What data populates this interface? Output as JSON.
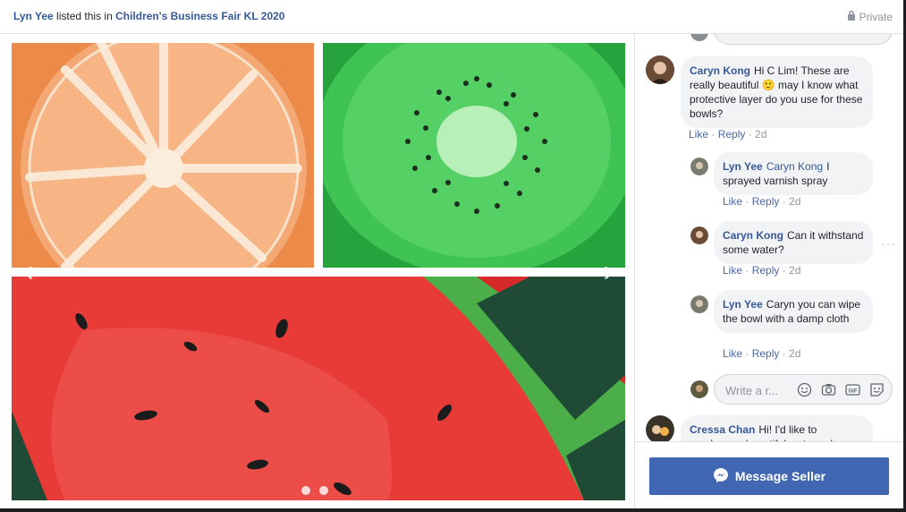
{
  "header": {
    "seller": "Lyn Yee",
    "listed_text": "listed this in",
    "group": "Children's Business Fair KL 2020",
    "privacy": "Private"
  },
  "photo": {
    "prev_icon": "chevron-left-icon",
    "next_icon": "chevron-right-icon",
    "dots": 2
  },
  "comments": [
    {
      "name": "Caryn Kong",
      "text": "Hi C Lim! These are really beautiful",
      "emoji": "🙂",
      "text2": "may I know what protective layer do you use for these bowls?",
      "like": "Like",
      "reply": "Reply",
      "time": "2d"
    },
    {
      "name": "Lyn Yee",
      "tag": "Caryn Kong",
      "text": "I sprayed varnish spray",
      "like": "Like",
      "reply": "Reply",
      "time": "2d"
    },
    {
      "name": "Caryn Kong",
      "text": "Can it withstand some water?",
      "like": "Like",
      "reply": "Reply",
      "time": "2d"
    },
    {
      "name": "Lyn Yee",
      "text": "Caryn you can wipe the bowl with a damp cloth",
      "like": "Like",
      "reply": "Reply",
      "time": "2d"
    },
    {
      "name": "Cressa Chan",
      "text": "Hi! I'd like to purchase a beautiful watermelon bowl"
    }
  ],
  "reply_box": {
    "placeholder": "Write a r..."
  },
  "footer": {
    "button": "Message Seller"
  },
  "colors": {
    "link": "#365899",
    "button": "#4267b2"
  }
}
